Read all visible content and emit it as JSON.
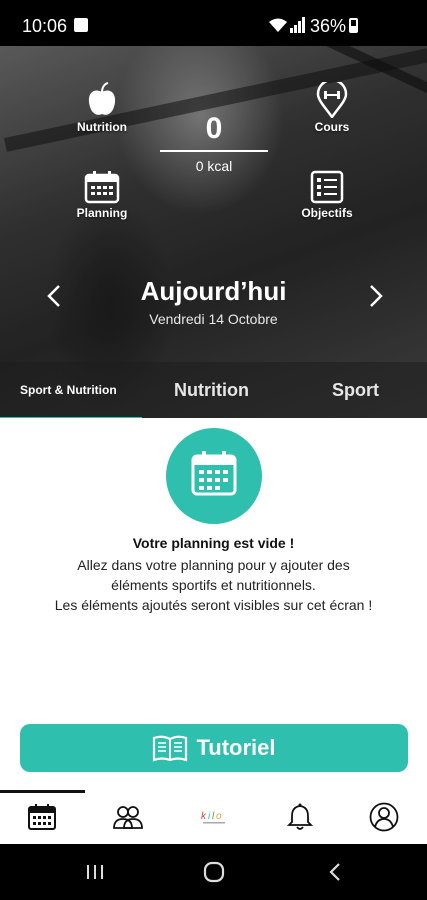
{
  "status_bar": {
    "time": "10:06",
    "battery": "36%"
  },
  "hero": {
    "nutrition_label": "Nutrition",
    "cours_label": "Cours",
    "planning_label": "Planning",
    "objectifs_label": "Objectifs",
    "kcal_value": "0",
    "kcal_unit": "0 kcal",
    "day_title": "Aujourd’hui",
    "day_date": "Vendredi 14 Octobre"
  },
  "tabs": [
    {
      "label": "Sport & Nutrition",
      "active": true
    },
    {
      "label": "Nutrition",
      "active": false
    },
    {
      "label": "Sport",
      "active": false
    }
  ],
  "empty_state": {
    "title": "Votre planning est vide !",
    "line1": "Allez dans votre planning pour y ajouter des",
    "line2": "éléments sportifs et nutritionnels.",
    "line3": "Les éléments ajoutés seront visibles sur cet écran !"
  },
  "tutorial_button": {
    "label": "Tutoriel"
  },
  "bottom_nav": [
    "calendar-icon",
    "community-icon",
    "logo-icon",
    "bell-icon",
    "profile-icon"
  ],
  "colors": {
    "accent": "#2fbfae",
    "dark": "#111111"
  }
}
